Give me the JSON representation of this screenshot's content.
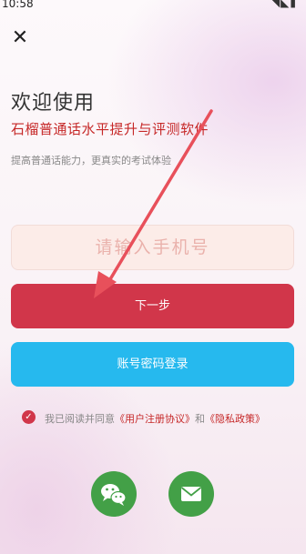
{
  "status": {
    "time": "10:58",
    "icons": "◥◣▮"
  },
  "close": {
    "glyph": "✕"
  },
  "header": {
    "welcome": "欢迎使用",
    "subtitle": "石榴普通话水平提升与评测软件",
    "description": "提高普通话能力，更真实的考试体验"
  },
  "form": {
    "phone_placeholder": "请输入手机号",
    "next_label": "下一步",
    "password_login_label": "账号密码登录"
  },
  "agreement": {
    "checked": true,
    "prefix": "我已阅读并同意",
    "user_agreement": "《用户注册协议》",
    "and": "和",
    "privacy_policy": "《隐私政策》"
  },
  "social": [
    {
      "name": "wechat-icon"
    },
    {
      "name": "mail-icon"
    }
  ],
  "colors": {
    "primary_red": "#d1364a",
    "accent_blue": "#26b9ee",
    "social_green": "#43a047",
    "annotation_arrow": "#e8505b"
  }
}
